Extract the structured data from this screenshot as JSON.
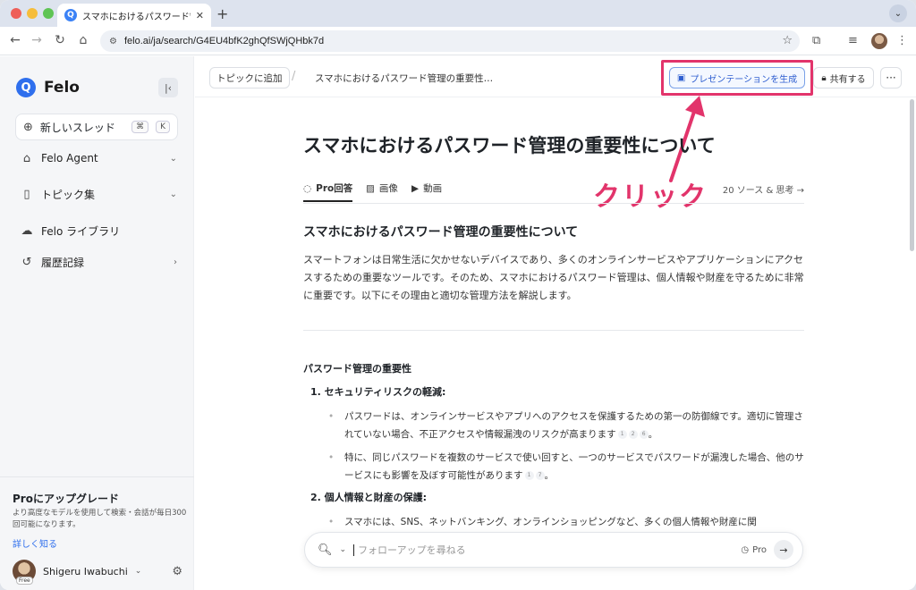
{
  "browser": {
    "tab_title": "スマホにおけるパスワード管理の",
    "url": "felo.ai/ja/search/G4EU4bfK2ghQfSWjQHbk7d"
  },
  "sidebar": {
    "brand": "Felo",
    "new_thread": "新しいスレッド",
    "shortcut_cmd": "⌘",
    "shortcut_key": "K",
    "items": [
      {
        "label": "Felo Agent"
      },
      {
        "label": "トピック集"
      },
      {
        "label": "Felo ライブラリ"
      },
      {
        "label": "履歴記録"
      }
    ],
    "upgrade_title": "Proにアップグレード",
    "upgrade_desc": "より高度なモデルを使用して検索・会話が毎日300回可能になります。",
    "upgrade_link": "詳しく知る",
    "user_name": "Shigeru Iwabuchi",
    "user_badge": "Free"
  },
  "topbar": {
    "add_topic": "トピックに追加",
    "breadcrumb": "スマホにおけるパスワード管理の重要性…",
    "presentation": "プレゼンテーションを生成",
    "share": "共有する",
    "more": "···"
  },
  "annotation": {
    "text": "クリック",
    "color": "#e2346b"
  },
  "main": {
    "title": "スマホにおけるパスワード管理の重要性について",
    "tabs": [
      "Pro回答",
      "画像",
      "動画"
    ],
    "sources": "20 ソース & 思考 →",
    "h2": "スマホにおけるパスワード管理の重要性について",
    "intro": "スマートフォンは日常生活に欠かせないデバイスであり、多くのオンラインサービスやアプリケーションにアクセスするための重要なツールです。そのため、スマホにおけるパスワード管理は、個人情報や財産を守るために非常に重要です。以下にその理由と適切な管理方法を解説します。",
    "h3": "パスワード管理の重要性",
    "item1": "1.  セキュリティリスクの軽減:",
    "bullet1": "パスワードは、オンラインサービスやアプリへのアクセスを保護するための第一の防御線です。適切に管理されていない場合、不正アクセスや情報漏洩のリスクが高まります",
    "bullet1_cites": [
      "1",
      "2",
      "6"
    ],
    "bullet2": "特に、同じパスワードを複数のサービスで使い回すと、一つのサービスでパスワードが漏洩した場合、他のサービスにも影響を及ぼす可能性があります",
    "bullet2_cites": [
      "1",
      "7"
    ],
    "item2": "2.  個人情報と財産の保護:",
    "bullet3": "スマホには、SNS、ネットバンキング、オンラインショッピングなど、多くの個人情報や財産に関",
    "ask_placeholder": "フォローアップを尋ねる",
    "ask_mode": "Pro"
  }
}
